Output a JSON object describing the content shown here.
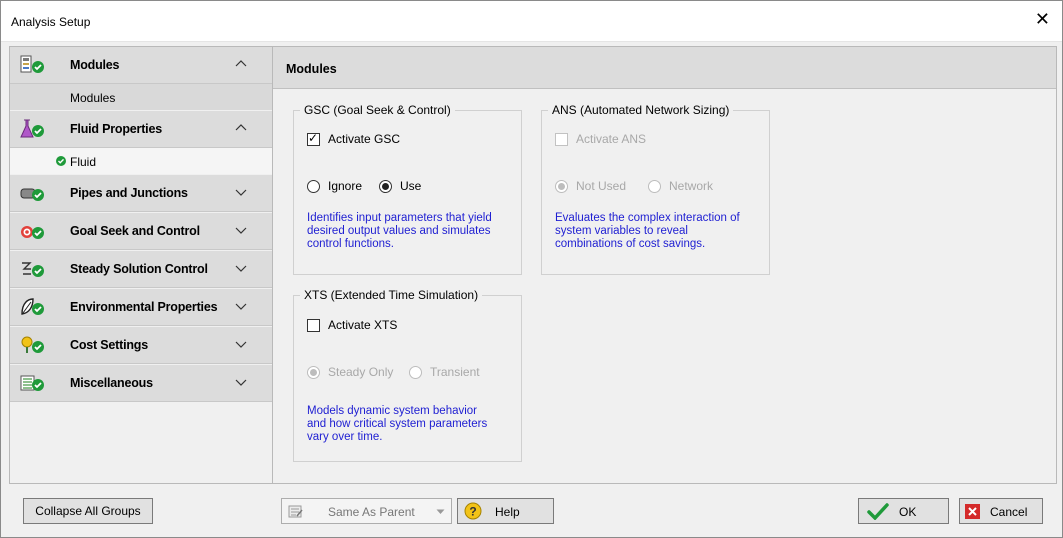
{
  "window": {
    "title": "Analysis Setup",
    "close_glyph": "✕"
  },
  "sidebar": {
    "groups": [
      {
        "label": "Modules",
        "icon": "modules-icon",
        "expanded": true
      },
      {
        "label": "Fluid Properties",
        "icon": "flask-icon",
        "expanded": true
      },
      {
        "label": "Pipes and Junctions",
        "icon": "pipe-icon",
        "expanded": false
      },
      {
        "label": "Goal Seek and Control",
        "icon": "target-icon",
        "expanded": false
      },
      {
        "label": "Steady Solution Control",
        "icon": "solver-icon",
        "expanded": false
      },
      {
        "label": "Environmental Properties",
        "icon": "leaf-icon",
        "expanded": false
      },
      {
        "label": "Cost Settings",
        "icon": "cost-icon",
        "expanded": false
      },
      {
        "label": "Miscellaneous",
        "icon": "misc-icon",
        "expanded": false
      }
    ],
    "subitems": {
      "modules": "Modules",
      "fluid": "Fluid"
    }
  },
  "main": {
    "header": "Modules",
    "gsc": {
      "legend": "GSC (Goal Seek & Control)",
      "activate_label": "Activate GSC",
      "activate_checked": true,
      "radio_ignore": "Ignore",
      "radio_use": "Use",
      "selected": "Use",
      "description": "Identifies input parameters that yield\ndesired output values and simulates\ncontrol functions."
    },
    "ans": {
      "legend": "ANS (Automated Network Sizing)",
      "activate_label": "Activate ANS",
      "activate_checked": false,
      "radio_not_used": "Not Used",
      "radio_network": "Network",
      "selected": "Not Used",
      "description": "Evaluates the complex interaction of\nsystem variables to reveal\ncombinations of cost savings."
    },
    "xts": {
      "legend": "XTS (Extended Time Simulation)",
      "activate_label": "Activate XTS",
      "activate_checked": false,
      "radio_steady": "Steady Only",
      "radio_transient": "Transient",
      "selected": "Steady Only",
      "description": "Models dynamic system behavior\nand how critical system parameters\nvary over time."
    }
  },
  "footer": {
    "collapse_all": "Collapse All Groups",
    "same_as_parent": "Same As Parent",
    "help": "Help",
    "ok": "OK",
    "cancel": "Cancel"
  },
  "colors": {
    "description_text": "#1e1ed2",
    "check_green": "#1f9a3a",
    "cancel_red": "#d42a2a"
  }
}
